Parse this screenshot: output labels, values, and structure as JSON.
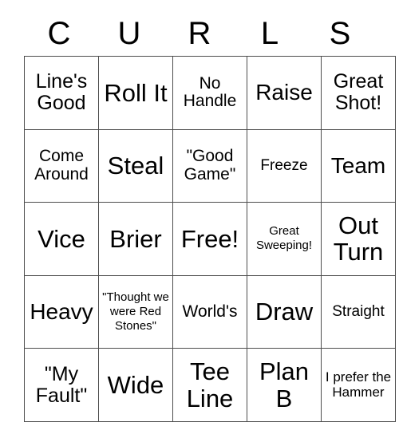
{
  "card": {
    "header_letters": [
      "C",
      "U",
      "R",
      "L",
      "S"
    ],
    "grid": {
      "columns": 5,
      "rows": 5,
      "border_color": "#4d4d4d",
      "background": "#ffffff",
      "text_color": "#000000"
    },
    "cells": [
      [
        {
          "text": "Line's Good",
          "size": "md"
        },
        {
          "text": "Roll It",
          "size": "xl"
        },
        {
          "text": "No Handle",
          "size": "sm"
        },
        {
          "text": "Raise",
          "size": "lg"
        },
        {
          "text": "Great Shot!",
          "size": "md"
        }
      ],
      [
        {
          "text": "Come Around",
          "size": "sm"
        },
        {
          "text": "Steal",
          "size": "xl"
        },
        {
          "text": "\"Good Game\"",
          "size": "sm"
        },
        {
          "text": "Freeze",
          "size": "xs"
        },
        {
          "text": "Team",
          "size": "lg"
        }
      ],
      [
        {
          "text": "Vice",
          "size": "xl"
        },
        {
          "text": "Brier",
          "size": "xl"
        },
        {
          "text": "Free!",
          "size": "xl"
        },
        {
          "text": "Great Sweeping!",
          "size": "tiny"
        },
        {
          "text": "Out Turn",
          "size": "xl"
        }
      ],
      [
        {
          "text": "Heavy",
          "size": "lg"
        },
        {
          "text": "\"Thought we were Red Stones\"",
          "size": "tiny"
        },
        {
          "text": "World's",
          "size": "sm"
        },
        {
          "text": "Draw",
          "size": "xl"
        },
        {
          "text": "Straight",
          "size": "xs"
        }
      ],
      [
        {
          "text": "\"My Fault\"",
          "size": "md"
        },
        {
          "text": "Wide",
          "size": "xl"
        },
        {
          "text": "Tee Line",
          "size": "xl"
        },
        {
          "text": "Plan B",
          "size": "xl"
        },
        {
          "text": "I prefer the Hammer",
          "size": "xxs"
        }
      ]
    ]
  }
}
